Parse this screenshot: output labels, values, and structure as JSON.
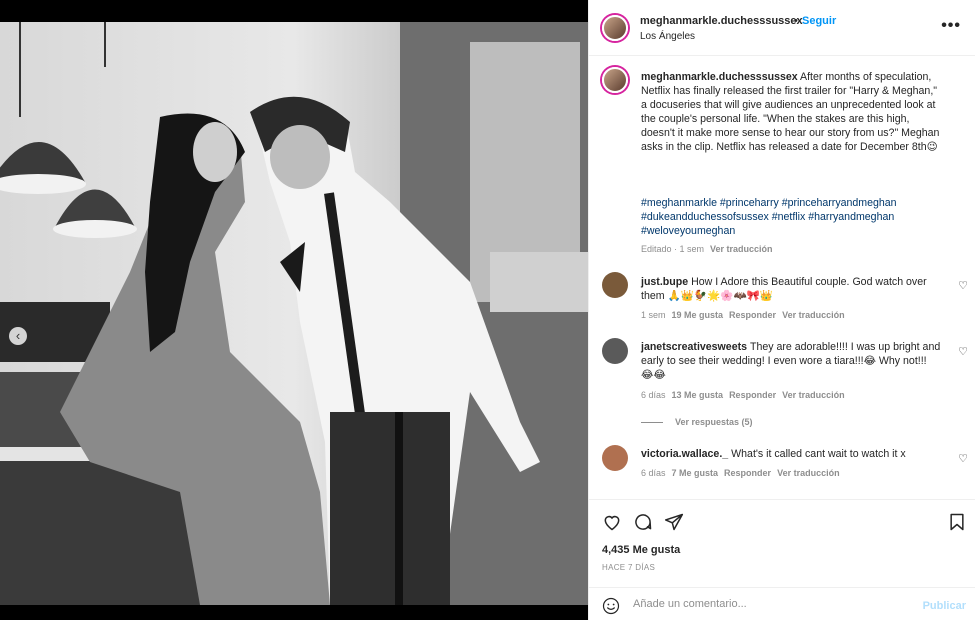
{
  "post": {
    "username": "meghanmarkle.duchesssussex",
    "separator": "•",
    "follow_label": "Seguir",
    "location": "Los Ángeles",
    "more_label": "•••",
    "caption_text": " After months of speculation, Netflix has finally released the first trailer for \"Harry & Meghan,\" a docuseries that will give audiences an unprecedented look at the couple's personal life. \"When the stakes are this high, doesn't it make more sense to hear our story from us?\" Meghan asks in the clip. Netflix has released a date for December 8th😉",
    "hashtags": "#meghanmarkle #princeharry #princeharryandmeghan #dukeandduchessofsussex #netflix #harryandmeghan #weloveyoumeghan",
    "caption_meta": "Editado · 1 sem",
    "caption_translate": "Ver traducción"
  },
  "comments": [
    {
      "user": "just.bupe",
      "text": "How I Adore this Beautiful couple. God watch over them 🙏👑🐓🌟🌸🦇🎀👑",
      "time": "1 sem",
      "likes": "19 Me gusta",
      "reply": "Responder",
      "translate": "Ver traducción",
      "avatar_color": "#7a5a3a"
    },
    {
      "user": "janetscreativesweets",
      "text": "They are adorable!!!! I was up bright and early to see their wedding! I even wore a tiara!!!😂 Why not!!! 😂😂",
      "time": "6 días",
      "likes": "13 Me gusta",
      "reply": "Responder",
      "translate": "Ver traducción",
      "view_replies": "Ver respuestas (5)",
      "avatar_color": "#5a5a5a"
    },
    {
      "user": "victoria.wallace._",
      "text": "What's it called cant wait to watch it x",
      "time": "6 días",
      "likes": "7 Me gusta",
      "reply": "Responder",
      "translate": "Ver traducción",
      "avatar_color": "#b07050"
    }
  ],
  "footer": {
    "likes": "4,435 Me gusta",
    "time_ago": "HACE 7 DÍAS",
    "comment_placeholder": "Añade un comentario...",
    "post_label": "Publicar"
  },
  "icons": {
    "like": "heart-icon",
    "comment": "comment-icon",
    "share": "share-icon",
    "save": "bookmark-icon",
    "emoji": "emoji-icon"
  },
  "colors": {
    "accent": "#0095f6",
    "hashtag": "#00376b",
    "muted": "#8e8e8e",
    "post_disabled": "#b2dffc"
  },
  "carousel": {
    "count": 2,
    "active": 2
  }
}
